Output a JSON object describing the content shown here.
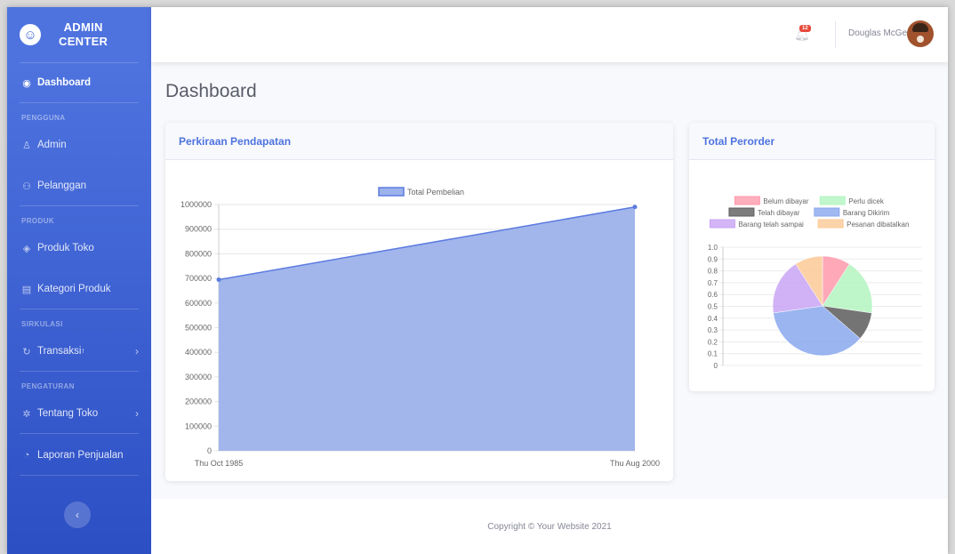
{
  "brand": {
    "icon": "laugh-wink-icon",
    "line1": "ADMIN",
    "line2": "CENTER"
  },
  "sidebar": {
    "dashboard": "Dashboard",
    "headings": [
      "PENGGUNA",
      "PRODUK",
      "SIRKULASI",
      "PENGATURAN"
    ],
    "items": [
      {
        "label": "Admin",
        "icon": "user-icon"
      },
      {
        "label": "Pelanggan",
        "icon": "users-icon"
      },
      {
        "label": "Produk Toko",
        "icon": "tag-icon"
      },
      {
        "label": "Kategori Produk",
        "icon": "folder-icon"
      },
      {
        "label": "Transaksi",
        "icon": "sync-icon",
        "superscript": "!"
      },
      {
        "label": "Tentang Toko",
        "icon": "cog-icon"
      },
      {
        "label": "Laporan Penjualan",
        "icon": "chart-icon"
      }
    ],
    "toggle_icon": "chevron-left-icon"
  },
  "topbar": {
    "alert_count": "12",
    "user_name": "Douglas McGee"
  },
  "page": {
    "title": "Dashboard"
  },
  "cards": {
    "earnings_title": "Perkiraan Pendapatan",
    "orders_title": "Total Perorder"
  },
  "chart_data": [
    {
      "type": "area",
      "title": "",
      "series": [
        {
          "name": "Total Pembelian",
          "x": [
            "Thu Oct 1985",
            "Thu Aug 2000"
          ],
          "values": [
            695000,
            990000
          ]
        }
      ],
      "ylim": [
        0,
        1000000
      ],
      "yticks": [
        "0",
        "100000",
        "200000",
        "300000",
        "400000",
        "500000",
        "600000",
        "700000",
        "800000",
        "900000",
        "1000000"
      ],
      "xticks": [
        "Thu Oct 1985",
        "Thu Aug 2000"
      ],
      "legend": "top",
      "colors": {
        "fill": "#9db2eb",
        "line": "#5b7be0"
      }
    },
    {
      "type": "pie",
      "title": "",
      "legend": "top",
      "labels": [
        "Belum dibayar",
        "Perlu dicek",
        "Telah dibayar",
        "Barang Dikirim",
        "Barang telah sampai",
        "Pesanan dibatalkan"
      ],
      "values": [
        1,
        2,
        1,
        4,
        2,
        1
      ],
      "colors": [
        "#ff9aac",
        "#b3f5c0",
        "#5c5c5c",
        "#8aa8ee",
        "#c9a4f5",
        "#fbc996"
      ],
      "yticks": [
        "0",
        "0.1",
        "0.2",
        "0.3",
        "0.4",
        "0.5",
        "0.6",
        "0.7",
        "0.8",
        "0.9",
        "1.0"
      ]
    }
  ],
  "footer": {
    "copyright": "Copyright © Your Website 2021"
  }
}
